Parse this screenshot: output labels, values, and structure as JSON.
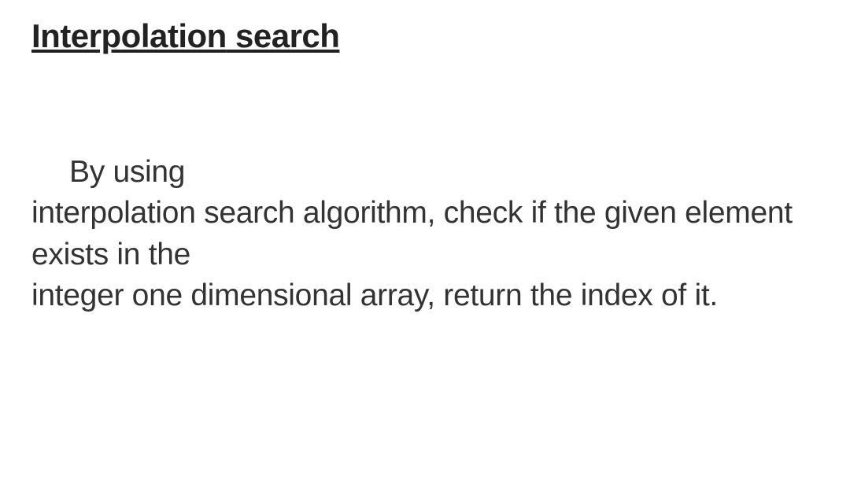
{
  "title": {
    "line1": "Interpolation",
    "line2": "search"
  },
  "body": {
    "line1": "By using",
    "line2": "interpolation search algorithm, check if the given element exists in the",
    "line3": "integer one dimensional array, return the index of it."
  }
}
